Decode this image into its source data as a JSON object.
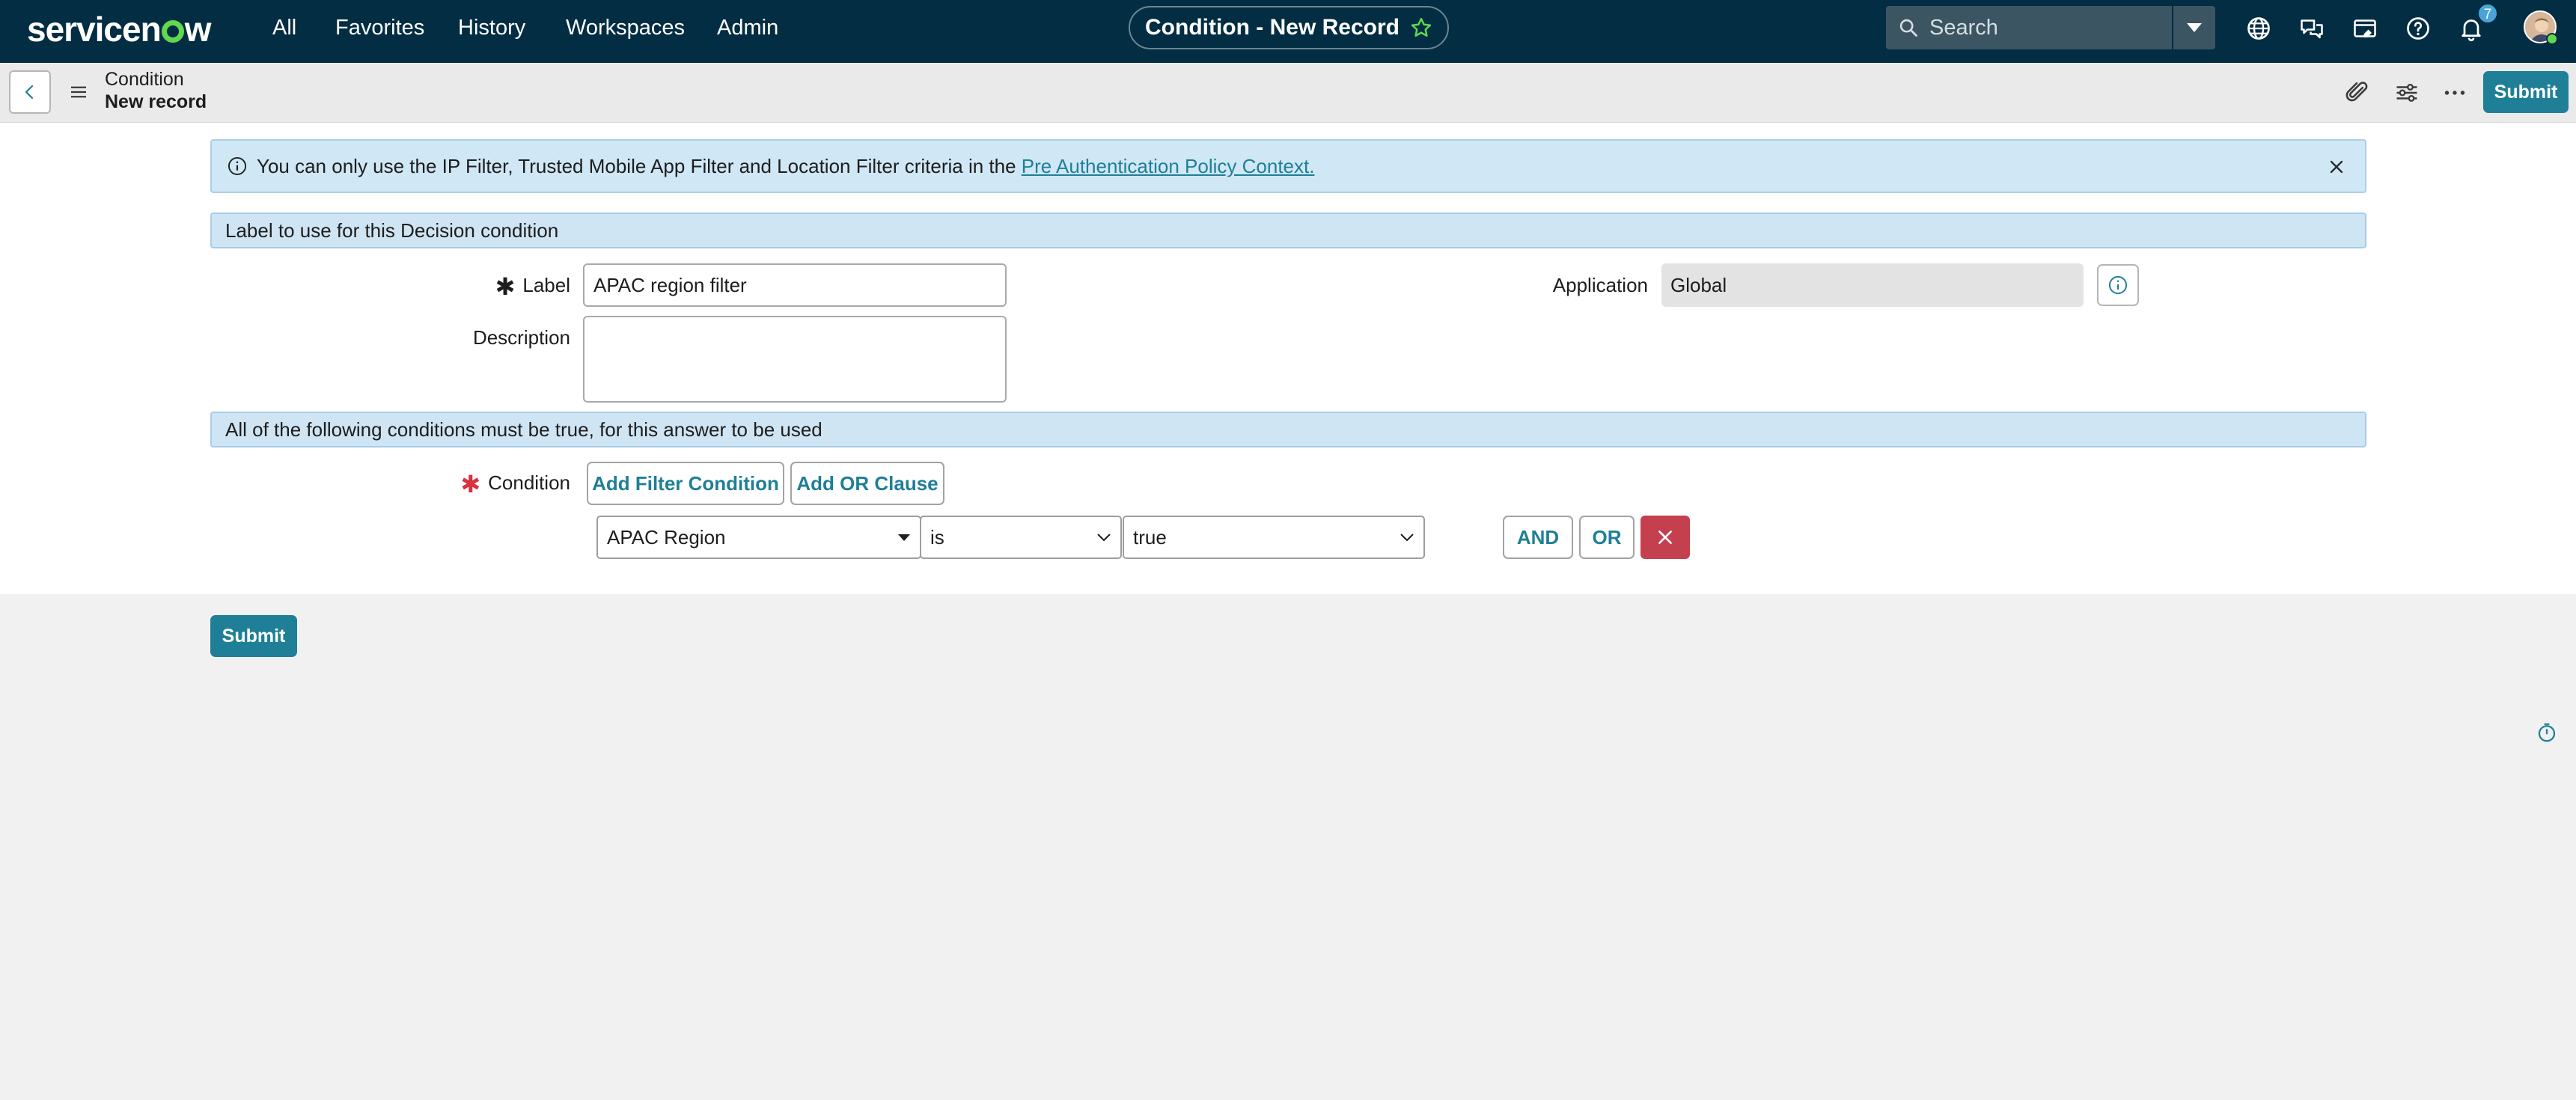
{
  "app": {
    "logo_text": "servicenow",
    "nav": [
      "All",
      "Favorites",
      "History",
      "Workspaces",
      "Admin"
    ],
    "page_title": "Condition - New Record",
    "search_placeholder": "Search",
    "notification_count": "7",
    "icons": [
      "globe-icon",
      "chat-icon",
      "sticky-note-icon",
      "help-icon",
      "bell-icon"
    ]
  },
  "record_header": {
    "title": "Condition",
    "subtitle": "New record",
    "submit_label": "Submit",
    "icons": [
      "paperclip-icon",
      "sliders-icon",
      "more-icon"
    ]
  },
  "banner": {
    "text": "You can only use the IP Filter, Trusted Mobile App Filter and Location Filter criteria in the ",
    "link": "Pre Authentication Policy Context."
  },
  "sections": {
    "label_section": "Label to use for this Decision condition",
    "conditions_section": "All of the following conditions must be true, for this answer to be used"
  },
  "form": {
    "label_label": "Label",
    "label_value": "APAC region filter",
    "description_label": "Description",
    "description_value": "",
    "application_label": "Application",
    "application_value": "Global",
    "condition_label": "Condition",
    "add_filter_label": "Add Filter Condition",
    "add_or_label": "Add OR Clause",
    "filter_field": "APAC Region",
    "filter_operator": "is",
    "filter_value": "true",
    "and_label": "AND",
    "or_label": "OR"
  },
  "footer": {
    "submit_label": "Submit"
  },
  "colors": {
    "top_bar": "#032d42",
    "accent": "#1f7f97",
    "banner_bg": "#d0e7f6",
    "delete": "#c5404e",
    "required": "#d8313f"
  }
}
